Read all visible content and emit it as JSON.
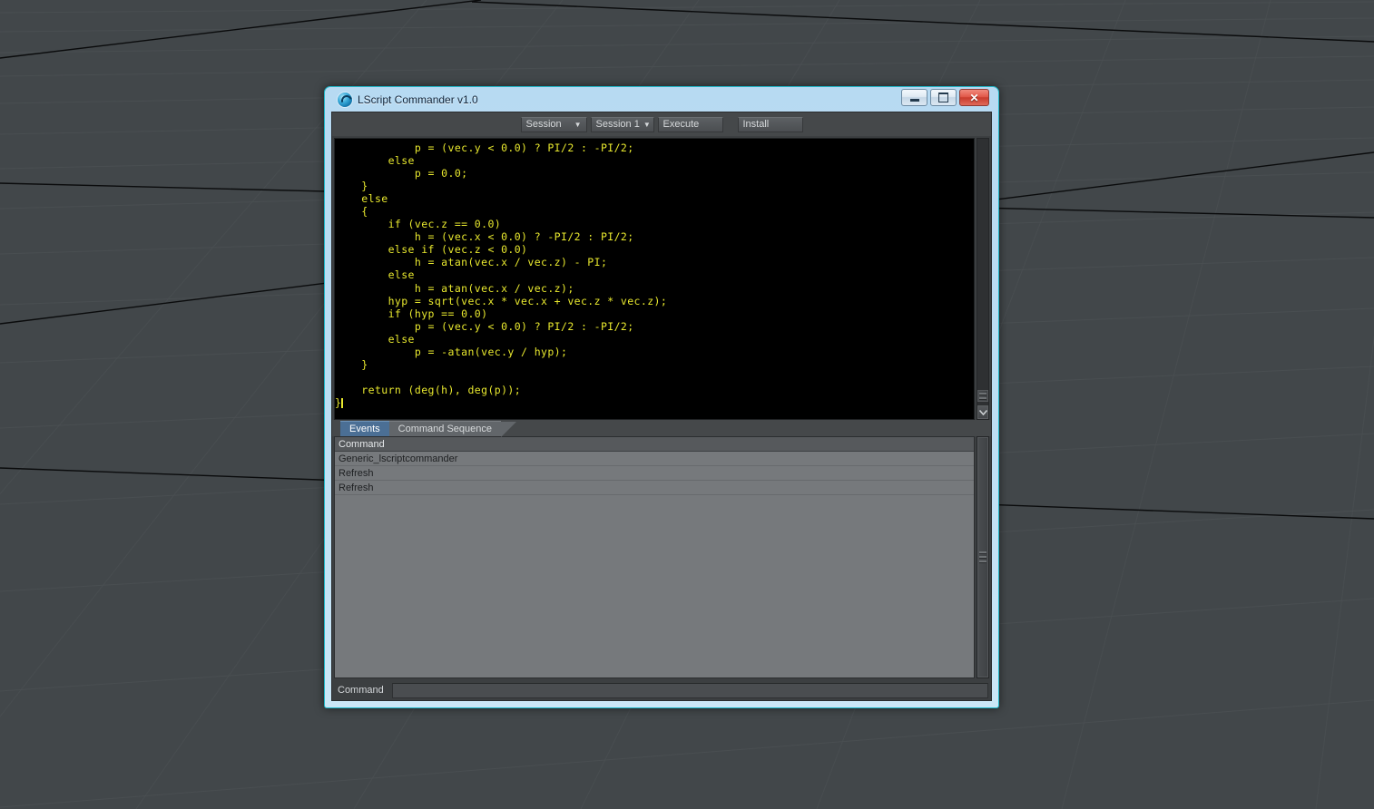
{
  "desktop": {
    "name": "3d-viewport-grid",
    "background_color": "#42474a",
    "grid_line_color": "#4b5053",
    "grid_major_color": "#0a0b0c"
  },
  "window": {
    "title": "LScript Commander v1.0",
    "icon": "lscript-spiral-icon",
    "border_accent": "#1fb8c9",
    "frame_color": "#bddef3",
    "controls": {
      "minimize_label": "–",
      "restore_label": "▭",
      "close_label": "✕"
    }
  },
  "toolbar": {
    "session_type": {
      "value": "Session",
      "caret": "▼"
    },
    "session_number": {
      "value": "Session 1",
      "caret": "▼"
    },
    "execute_label": "Execute",
    "install_label": "Install"
  },
  "editor": {
    "name": "lscript-code-editor",
    "text_color": "#e8e82e",
    "background_color": "#000000",
    "code": "            p = (vec.y < 0.0) ? PI/2 : -PI/2;\n        else\n            p = 0.0;\n    }\n    else\n    {\n        if (vec.z == 0.0)\n            h = (vec.x < 0.0) ? -PI/2 : PI/2;\n        else if (vec.z < 0.0)\n            h = atan(vec.x / vec.z) - PI;\n        else\n            h = atan(vec.x / vec.z);\n        hyp = sqrt(vec.x * vec.x + vec.z * vec.z);\n        if (hyp == 0.0)\n            p = (vec.y < 0.0) ? PI/2 : -PI/2;\n        else\n            p = -atan(vec.y / hyp);\n    }\n\n    return (deg(h), deg(p));\n",
    "last_line": "}",
    "scrollbar": {
      "down_arrow": "⌄"
    }
  },
  "tabs": [
    {
      "label": "Events",
      "active": true
    },
    {
      "label": "Command Sequence",
      "active": false
    }
  ],
  "list": {
    "name": "events-list",
    "columns": [
      "Command"
    ],
    "rows": [
      "Generic_lscriptcommander",
      "Refresh",
      "Refresh"
    ]
  },
  "command_bar": {
    "label": "Command",
    "value": "",
    "placeholder": ""
  }
}
